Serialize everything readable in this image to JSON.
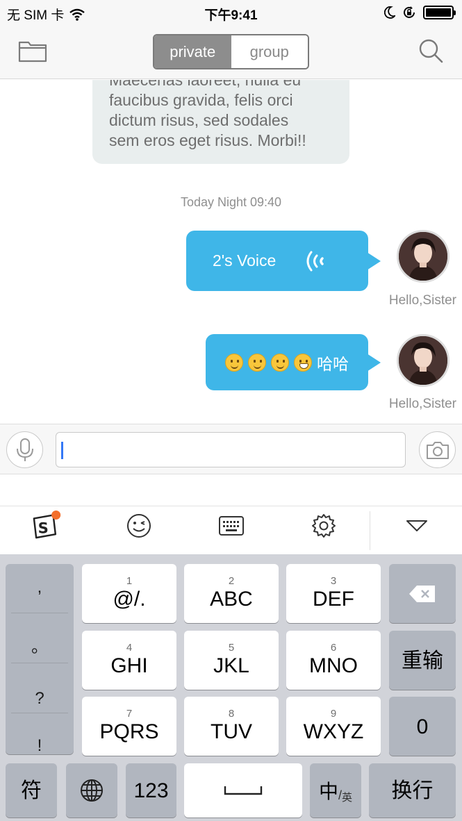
{
  "status_bar": {
    "carrier": "无 SIM 卡",
    "time": "下午9:41",
    "icons": [
      "wifi-icon",
      "moon-icon",
      "rotation-lock-icon",
      "battery-icon"
    ]
  },
  "nav": {
    "tabs": [
      {
        "label": "private",
        "active": true
      },
      {
        "label": "group",
        "active": false
      }
    ],
    "icons": [
      "folder-icon",
      "search-icon"
    ]
  },
  "chat": {
    "incoming_text_lines": [
      "Maecenas laoreet, nulla eu",
      "faucibus gravida, felis orci",
      "dictum risus, sed sodales",
      "sem eros eget risus. Morbi!!"
    ],
    "timestamp": "Today Night 09:40",
    "messages": [
      {
        "type": "voice",
        "text": "2's Voice",
        "sender": "Hello,Sister"
      },
      {
        "type": "emoji",
        "text": "哈哈",
        "emojis": [
          "slightly-smiling-face",
          "slightly-smiling-face",
          "slightly-smiling-face",
          "grinning-face"
        ],
        "sender": "Hello,Sister"
      }
    ]
  },
  "input_bar": {
    "value": "",
    "icons": [
      "microphone-icon",
      "camera-icon"
    ]
  },
  "keyboard_toolbar": {
    "badge": "!",
    "icons": [
      "sogou-logo-icon",
      "wink-emoji-icon",
      "keyboard-icon",
      "gear-icon",
      "chevron-down-icon"
    ]
  },
  "keyboard": {
    "side_punct": [
      ",",
      "。",
      "?",
      "!"
    ],
    "keys": [
      {
        "num": "1",
        "label": "@/."
      },
      {
        "num": "2",
        "label": "ABC"
      },
      {
        "num": "3",
        "label": "DEF"
      },
      {
        "num": "4",
        "label": "GHI"
      },
      {
        "num": "5",
        "label": "JKL"
      },
      {
        "num": "6",
        "label": "MNO"
      },
      {
        "num": "7",
        "label": "PQRS"
      },
      {
        "num": "8",
        "label": "TUV"
      },
      {
        "num": "9",
        "label": "WXYZ"
      }
    ],
    "right_keys": {
      "reenter": "重输",
      "zero": "0"
    },
    "bottom_row": {
      "symbols": "符",
      "numbers": "123",
      "space": "␣",
      "lang_main": "中",
      "lang_sub": "英",
      "newline": "换行"
    }
  }
}
